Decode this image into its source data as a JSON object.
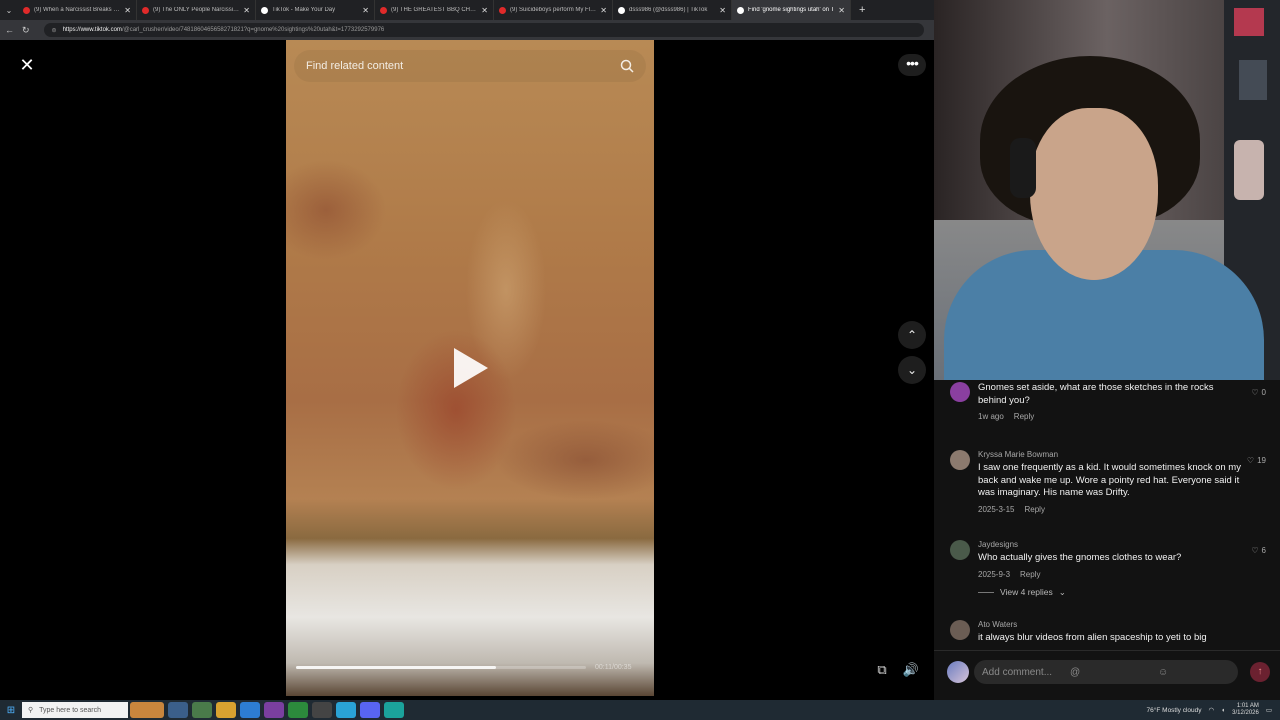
{
  "browser": {
    "tabs": [
      {
        "title": "(9) When a Narcissist Breaks the",
        "active": false,
        "color": "#e02a2a"
      },
      {
        "title": "(9) The ONLY People Narcissists",
        "active": false,
        "color": "#e02a2a"
      },
      {
        "title": "TikTok - Make Your Day",
        "active": false,
        "color": "#ffffff"
      },
      {
        "title": "(9) THE GREATEST BBQ CHALLEN",
        "active": false,
        "color": "#e02a2a"
      },
      {
        "title": "(9) Suicideboys perform My Flaw",
        "active": false,
        "color": "#e02a2a"
      },
      {
        "title": "dsss986 (@dsss986) | TikTok",
        "active": false,
        "color": "#ffffff"
      },
      {
        "title": "Find 'gnome sightings utah' on T",
        "active": true,
        "color": "#ffffff"
      }
    ],
    "new_tab": "+",
    "url_domain": "https://www.tiktok.com",
    "url_path": "/@carl_crusher/video/7481860465658271821?q=gnome%20sightings%20utah&t=1773292579976"
  },
  "player": {
    "close_icon": "✕",
    "more_icon": "•••",
    "search_placeholder": "Find related content",
    "timecode": "00:11/00:35",
    "progress": 0.69,
    "prev_icon": "⌃",
    "next_icon": "⌄",
    "pip_icon": "⧉",
    "volume_icon": "🔊"
  },
  "comments": [
    {
      "name": "",
      "text": "Gnomes set aside, what are those sketches in the rocks behind you?",
      "date": "1w ago",
      "reply": "Reply",
      "likes": "0",
      "avatar_color": "#8a3fa0"
    },
    {
      "name": "Kryssa Marie Bowman",
      "text": "I saw one frequently as a kid. It would sometimes knock on my back and wake me up. Wore a pointy red hat. Everyone said it was imaginary. His name was Drifty.",
      "date": "2025-3-15",
      "reply": "Reply",
      "likes": "19",
      "avatar_color": "#8c7a6e"
    },
    {
      "name": "Jaydesigns",
      "text": "Who actually gives the gnomes clothes to wear?",
      "date": "2025-9-3",
      "reply": "Reply",
      "likes": "6",
      "avatar_color": "#4a5a4a",
      "view_replies": "View 4 replies"
    },
    {
      "name": "Ato Waters",
      "text": "it always blur videos from alien spaceship to yeti to big",
      "date": "",
      "reply": "",
      "likes": "",
      "avatar_color": "#6b5d54"
    }
  ],
  "composer": {
    "placeholder": "Add comment...",
    "at_icon": "@",
    "emoji_icon": "☺",
    "send_icon": "↑"
  },
  "taskbar": {
    "search_placeholder": "Type here to search",
    "weather": "76°F  Mostly cloudy",
    "time": "1:01 AM",
    "date": "3/12/2026"
  }
}
